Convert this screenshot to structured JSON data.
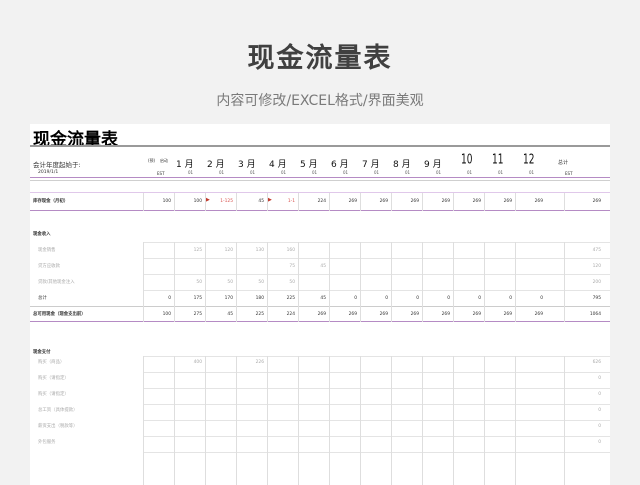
{
  "page": {
    "title": "现金流量表",
    "subtitle": "内容可修改/EXCEL格式/界面美观"
  },
  "sheet": {
    "title": "现金流量表",
    "fiscal_label": "会计年度起始于:",
    "fiscal_date": "2019/1/1",
    "pre_start_label_1": "(预)",
    "pre_start_label_2": "启动",
    "pre_start_sub": "EST",
    "months": [
      {
        "label": "1 月",
        "sub": "01"
      },
      {
        "label": "2 月",
        "sub": "01"
      },
      {
        "label": "3 月",
        "sub": "01"
      },
      {
        "label": "4 月",
        "sub": "01"
      },
      {
        "label": "5 月",
        "sub": "01"
      },
      {
        "label": "6 月",
        "sub": "01"
      },
      {
        "label": "7 月",
        "sub": "01"
      },
      {
        "label": "8 月",
        "sub": "01"
      },
      {
        "label": "9 月",
        "sub": "01"
      },
      {
        "label": "10",
        "sub": "01"
      },
      {
        "label": "11",
        "sub": "01"
      },
      {
        "label": "12",
        "sub": "01"
      }
    ],
    "total_label": "总计",
    "total_sub": "EST",
    "opening": {
      "label": "库存现金（月初）",
      "pre": "100",
      "values": [
        "100",
        "1-125",
        "45",
        "1-1",
        "224",
        "269",
        "269",
        "269",
        "269",
        "269",
        "269",
        "269"
      ],
      "total": "269"
    },
    "income_header": "现金收入",
    "income_rows": [
      {
        "label": "现金销售",
        "pre": "",
        "values": [
          "125",
          "120",
          "130",
          "160",
          "",
          "",
          "",
          "",
          "",
          "",
          "",
          ""
        ],
        "total": "475"
      },
      {
        "label": "贷方应收款",
        "pre": "",
        "values": [
          "",
          "",
          "",
          "75",
          "45",
          "",
          "",
          "",
          "",
          "",
          "",
          ""
        ],
        "total": "120"
      },
      {
        "label": "贷款/其他现金注入",
        "pre": "",
        "values": [
          "50",
          "50",
          "50",
          "50",
          "",
          "",
          "",
          "",
          "",
          "",
          "",
          ""
        ],
        "total": "200"
      }
    ],
    "income_total": {
      "label": "总计",
      "pre": "0",
      "values": [
        "175",
        "170",
        "180",
        "225",
        "45",
        "0",
        "0",
        "0",
        "0",
        "0",
        "0",
        "0"
      ],
      "total": "795"
    },
    "available": {
      "label": "总可用现金（现金支出前）",
      "pre": "100",
      "values": [
        "275",
        "45",
        "225",
        "224",
        "269",
        "269",
        "269",
        "269",
        "269",
        "269",
        "269",
        "269"
      ],
      "total": "1064"
    },
    "expense_header": "现金支付",
    "expense_rows": [
      {
        "label": "购买（商品）",
        "values": [
          "400",
          "",
          "226",
          "",
          "",
          "",
          "",
          "",
          "",
          "",
          "",
          ""
        ],
        "total": "626"
      },
      {
        "label": "购买（请指定）",
        "values": [
          "",
          "",
          "",
          "",
          "",
          "",
          "",
          "",
          "",
          "",
          "",
          ""
        ],
        "total": "0"
      },
      {
        "label": "购买（请指定）",
        "values": [
          "",
          "",
          "",
          "",
          "",
          "",
          "",
          "",
          "",
          "",
          "",
          ""
        ],
        "total": "0"
      },
      {
        "label": "总工资（具体提款）",
        "values": [
          "",
          "",
          "",
          "",
          "",
          "",
          "",
          "",
          "",
          "",
          "",
          ""
        ],
        "total": "0"
      },
      {
        "label": "薪资支出（税款等）",
        "values": [
          "",
          "",
          "",
          "",
          "",
          "",
          "",
          "",
          "",
          "",
          "",
          ""
        ],
        "total": "0"
      },
      {
        "label": "外包服务",
        "values": [
          "",
          "",
          "",
          "",
          "",
          "",
          "",
          "",
          "",
          "",
          "",
          ""
        ],
        "total": "0"
      }
    ]
  },
  "colors": {
    "accent_line": "#b58bc4",
    "flag": "#c0392b",
    "negative_text": "#d9534f"
  }
}
